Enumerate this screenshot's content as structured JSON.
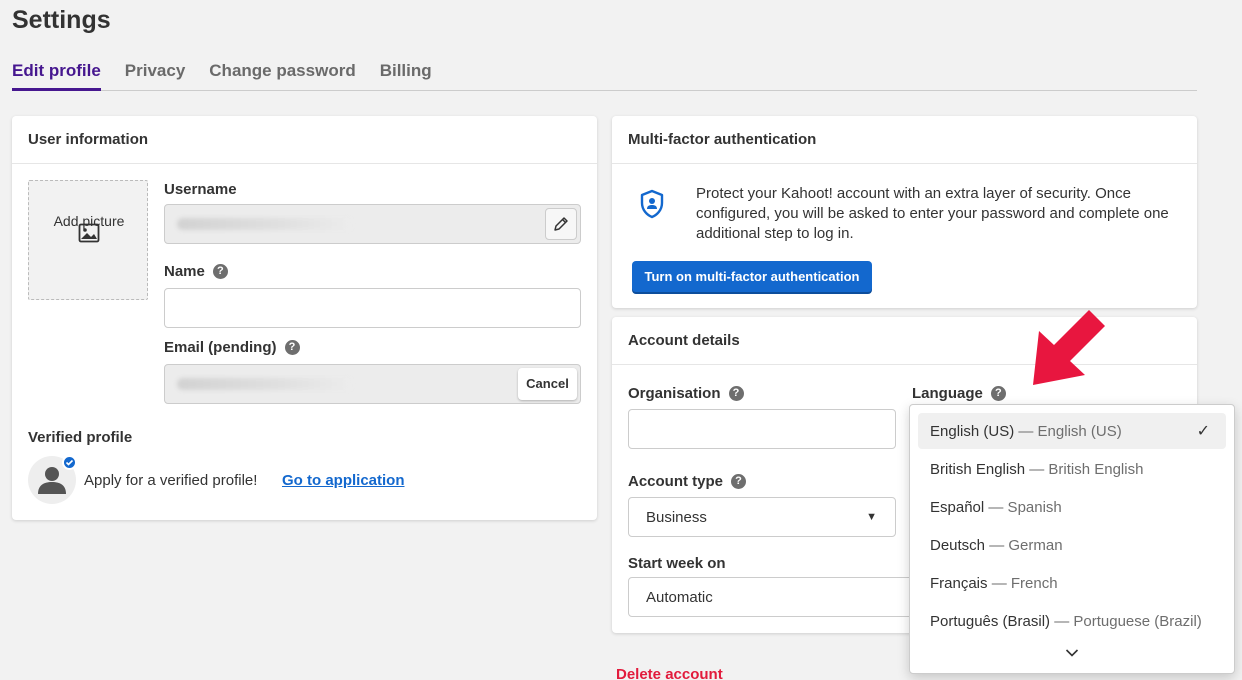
{
  "page": {
    "title": "Settings"
  },
  "tabs": [
    {
      "label": "Edit profile",
      "active": true
    },
    {
      "label": "Privacy",
      "active": false
    },
    {
      "label": "Change password",
      "active": false
    },
    {
      "label": "Billing",
      "active": false
    }
  ],
  "user_info": {
    "title": "User information",
    "add_picture": "Add picture",
    "username_label": "Username",
    "name_label": "Name",
    "email_label": "Email (pending)",
    "cancel_label": "Cancel",
    "verified_title": "Verified profile",
    "verified_text": "Apply for a verified profile!",
    "verified_link": "Go to application"
  },
  "mfa": {
    "title": "Multi-factor authentication",
    "description": "Protect your Kahoot! account with an extra layer of security. Once configured, you will be asked to enter your password and complete one additional step to log in.",
    "button": "Turn on multi-factor authentication"
  },
  "account": {
    "title": "Account details",
    "organisation_label": "Organisation",
    "language_label": "Language",
    "account_type_label": "Account type",
    "account_type_value": "Business",
    "start_week_label": "Start week on",
    "start_week_value": "Automatic"
  },
  "language_dropdown": {
    "options": [
      {
        "native": "English (US)",
        "english": "— English (US)",
        "selected": true
      },
      {
        "native": "British English",
        "english": "— British English",
        "selected": false
      },
      {
        "native": "Español",
        "english": "— Spanish",
        "selected": false
      },
      {
        "native": "Deutsch",
        "english": "— German",
        "selected": false
      },
      {
        "native": "Français",
        "english": "— French",
        "selected": false
      },
      {
        "native": "Português (Brasil)",
        "english": "— Portuguese (Brazil)",
        "selected": false
      }
    ]
  },
  "delete_account": "Delete account",
  "colors": {
    "accent": "#46178f",
    "primary_button": "#1368ce",
    "link": "#1368ce",
    "danger": "#e21b3c",
    "annotation_arrow": "#e8163f"
  },
  "icons": {
    "add_picture": "image-icon",
    "edit": "pencil-icon",
    "mfa": "shield-user-icon",
    "avatar": "user-avatar-icon",
    "verified": "check-badge-icon",
    "help": "question-mark-icon",
    "check": "check-icon",
    "caret": "caret-down-icon",
    "more": "chevron-down-icon"
  }
}
